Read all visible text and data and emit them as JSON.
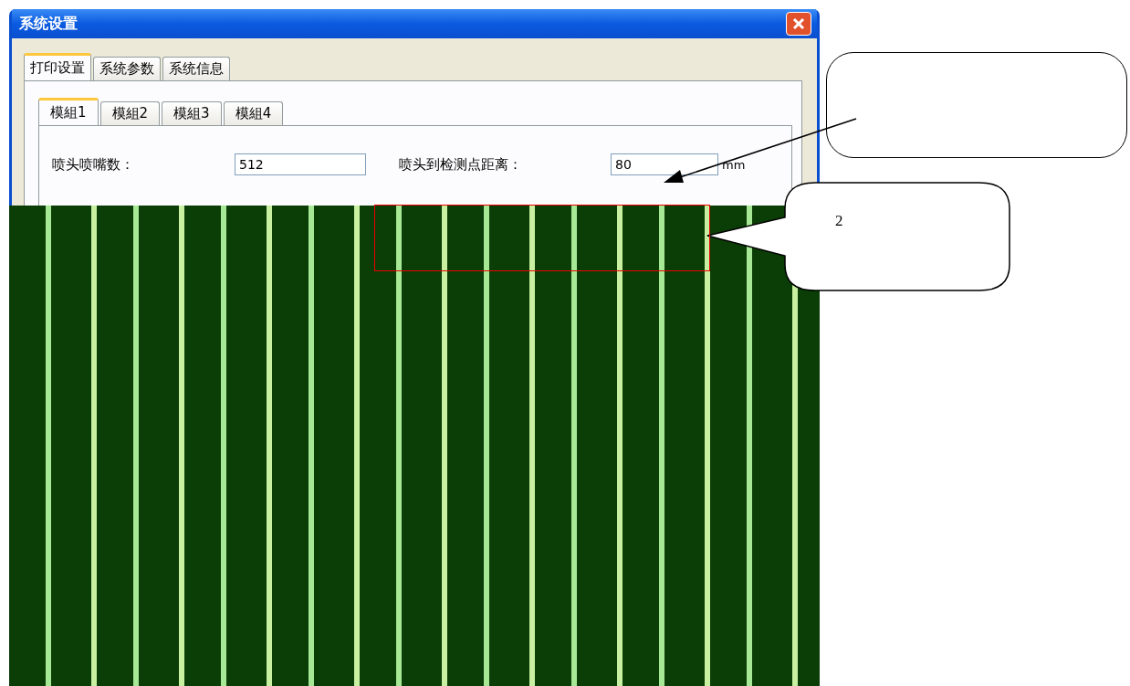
{
  "window": {
    "title": "系统设置"
  },
  "tabs": [
    {
      "label": "打印设置",
      "selected": true
    },
    {
      "label": "系统参数",
      "selected": false
    },
    {
      "label": "系统信息",
      "selected": false
    }
  ],
  "subtabs": [
    {
      "label": "模組1",
      "selected": true
    },
    {
      "label": "模組2",
      "selected": false
    },
    {
      "label": "模組3",
      "selected": false
    },
    {
      "label": "模組4",
      "selected": false
    }
  ],
  "fields": [
    {
      "label": "喷头喷嘴数：",
      "value": "512"
    },
    {
      "label": "喷头到检测点距离：",
      "value": "80",
      "unit": "mm"
    }
  ],
  "annotations": [
    {
      "kind": "arrow-callout"
    },
    {
      "kind": "label-callout",
      "text": "2"
    },
    {
      "kind": "frame"
    }
  ]
}
